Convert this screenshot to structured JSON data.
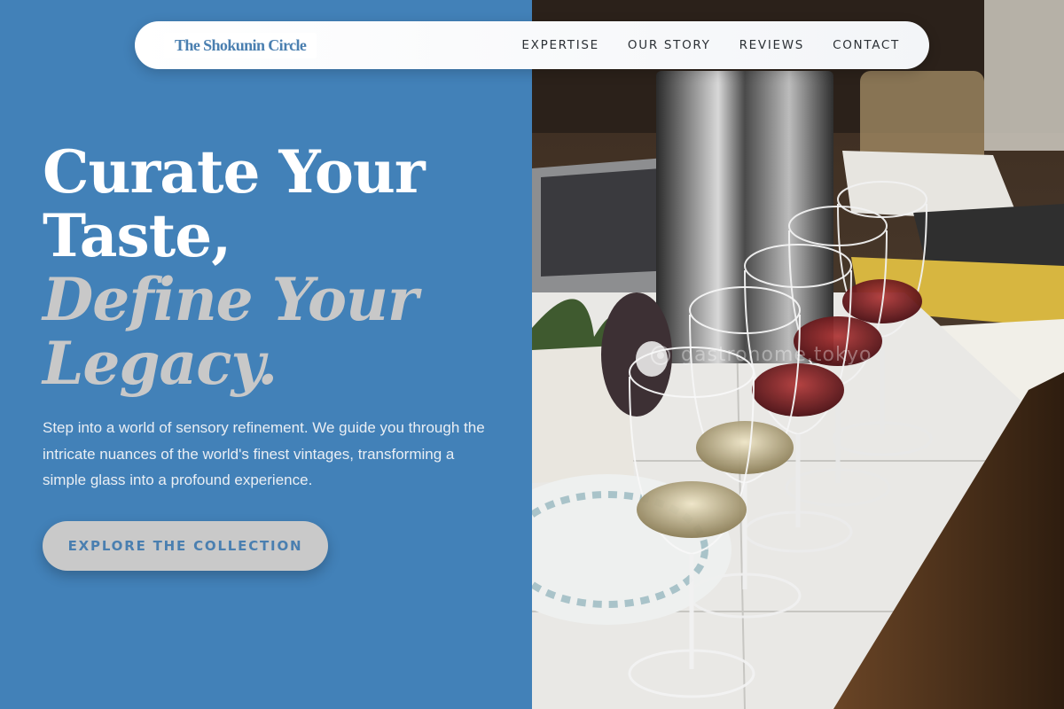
{
  "brand": {
    "logo_text": "The Shokunin Circle"
  },
  "nav": {
    "items": [
      {
        "label": "EXPERTISE"
      },
      {
        "label": "OUR STORY"
      },
      {
        "label": "REVIEWS"
      },
      {
        "label": "CONTACT"
      }
    ]
  },
  "hero": {
    "headline_line1": "Curate Your",
    "headline_line2": "Taste,",
    "headline_line3": "Define Your",
    "headline_line4": "Legacy.",
    "intro": "Step into a world of sensory refinement. We guide you through the intricate nuances of the world's finest vintages, transforming a simple glass into a profound experience.",
    "cta_label": "EXPLORE THE COLLECTION"
  },
  "photo": {
    "watermark": "gastronome.tokyo",
    "icons": [
      "wine-glass-icon",
      "camera-icon"
    ]
  },
  "colors": {
    "primary": "#4281b8",
    "accent_text": "#c8c8c8",
    "button_bg": "#c9c9c9",
    "nav_text": "#2c3136"
  }
}
